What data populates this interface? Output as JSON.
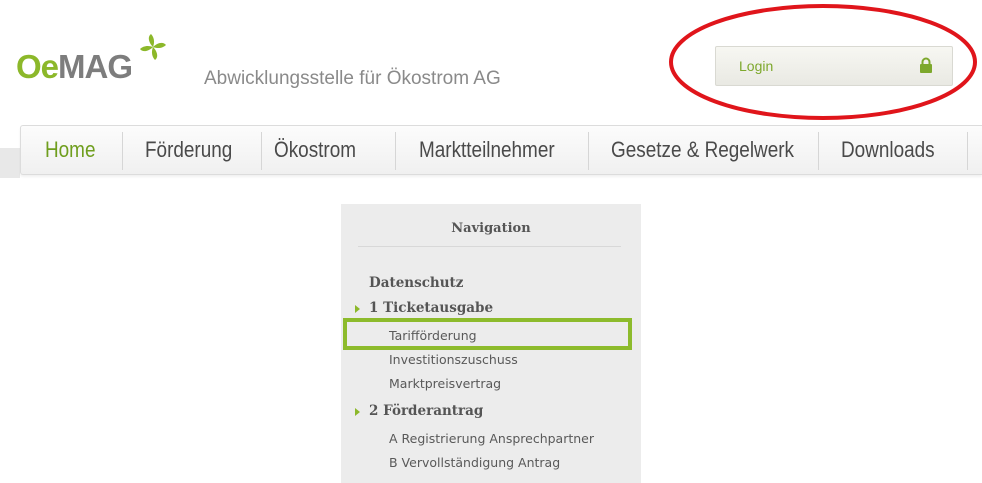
{
  "brand": {
    "logo_oe": "Oe",
    "logo_mag": "MAG",
    "tagline": "Abwicklungsstelle für Ökostrom AG",
    "accent_color": "#8cb82a"
  },
  "login": {
    "label": "Login",
    "icon": "lock-icon"
  },
  "nav": {
    "items": [
      {
        "label": "Home",
        "active": true
      },
      {
        "label": "Förderung",
        "active": false
      },
      {
        "label": "Ökostrom",
        "active": false
      },
      {
        "label": "Marktteilnehmer",
        "active": false
      },
      {
        "label": "Gesetze & Regelwerk",
        "active": false
      },
      {
        "label": "Downloads",
        "active": false
      }
    ]
  },
  "navigation_panel": {
    "title": "Navigation",
    "items": [
      {
        "label": "Datenschutz",
        "level": 0
      },
      {
        "label": "1 Ticketausgabe",
        "level": 0,
        "expandable": true
      },
      {
        "label": "Tarifförderung",
        "level": 1,
        "highlighted": true
      },
      {
        "label": "Investitionszuschuss",
        "level": 1
      },
      {
        "label": "Marktpreisvertrag",
        "level": 1
      },
      {
        "label": "2 Förderantrag",
        "level": 0,
        "expandable": true
      },
      {
        "label": "A Registrierung Ansprechpartner",
        "level": 1
      },
      {
        "label": "B Vervollständigung Antrag",
        "level": 1
      }
    ]
  },
  "annotations": {
    "login_circle_color": "#e0151b",
    "highlight_color": "#8dbb2c"
  }
}
